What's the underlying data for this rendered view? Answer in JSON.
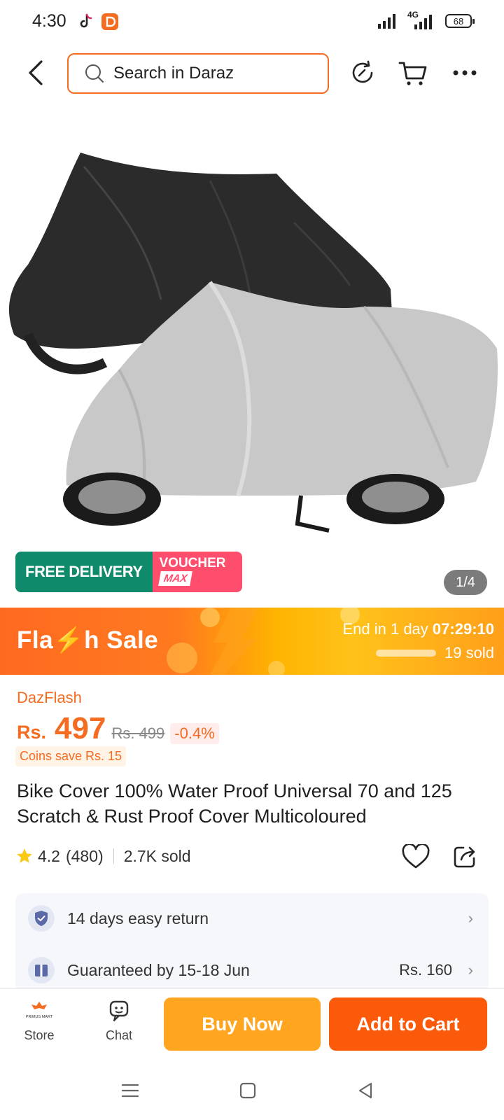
{
  "status": {
    "time": "4:30",
    "network": "4G",
    "battery": "68"
  },
  "search": {
    "placeholder": "Search in Daraz"
  },
  "gallery": {
    "badge_free": "FREE DELIVERY",
    "badge_voucher": "VOUCHER",
    "badge_max": "MAX",
    "pager": "1/4"
  },
  "flash": {
    "title": "Fla⚡h  Sale",
    "end_prefix": "End in 1 day",
    "end_time": "07:29:10",
    "sold": "19 sold"
  },
  "product": {
    "campaign": "DazFlash",
    "currency": "Rs.",
    "price": "497",
    "old_price": "Rs. 499",
    "discount": "-0.4%",
    "coins": "Coins save Rs. 15",
    "title": "Bike Cover 100% Water Proof Universal 70 and 125 Scratch & Rust Proof Cover Multicoloured",
    "rating": "4.2",
    "reviews": "(480)",
    "sold": "2.7K sold"
  },
  "info": {
    "return": "14 days easy return",
    "delivery": "Guaranteed by 15-18 Jun",
    "delivery_price": "Rs. 160"
  },
  "bottom": {
    "store": "Store",
    "store_logo_text": "PRIMUS MART",
    "chat": "Chat",
    "buy_now": "Buy Now",
    "add_to_cart": "Add to Cart"
  },
  "colors": {
    "accent": "#f36c21",
    "buy": "#ffa51f",
    "cart": "#fa5a0a",
    "free_delivery": "#0f8a6a",
    "voucher": "#ff4d6d"
  }
}
